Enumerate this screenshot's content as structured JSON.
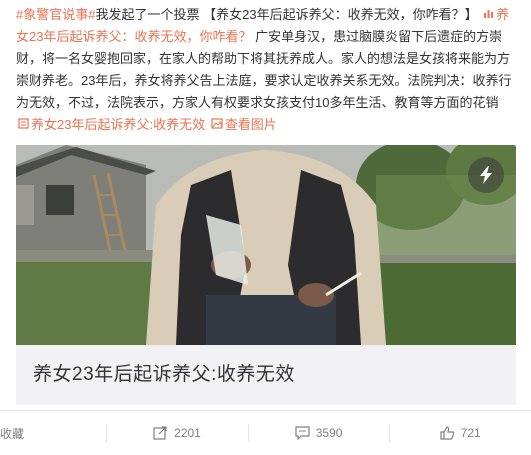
{
  "post": {
    "hashtag": "#象警官说事#",
    "intro": "我发起了一个投票",
    "poll_title": "【养女23年后起诉养父：收养无效，你咋看？】",
    "poll_link": "养女23年后起诉养父：收养无效，你咋看？",
    "body": "广安单身汉，患过脑膜炎留下后遗症的方崇财，将一名女婴抱回家，在家人的帮助下将其抚养成人。家人的想法是女孩将来能为方崇财养老。23年后，养女将养父告上法庭，要求认定收养关系无效。法院判决：收养行为无效，不过，法院表示，方家人有权要求女孩支付10多年生活、教育等方面的花销",
    "article_link": "养女23年后起诉养父:收养无效",
    "view_image": "查看图片"
  },
  "card": {
    "title": "养女23年后起诉养父:收养无效"
  },
  "actions": {
    "favorite": "收藏",
    "repost": "2201",
    "comment": "3590",
    "like": "721"
  },
  "icons": {
    "poll": "poll-icon",
    "article": "article-icon",
    "image": "image-icon",
    "play": "lightning-play-icon",
    "repost": "repost-icon",
    "comment": "comment-icon",
    "like": "thumbs-up-icon"
  },
  "colors": {
    "link": "#eb7350",
    "text": "#333333",
    "muted": "#808080"
  }
}
